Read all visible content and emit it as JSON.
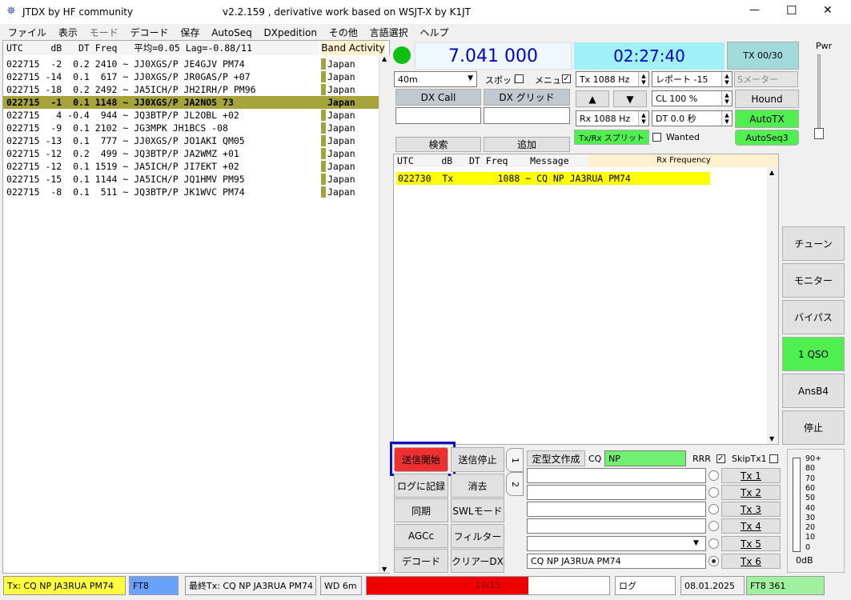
{
  "window": {
    "title": "JTDX  by HF community",
    "version": "v2.2.159 , derivative work based on WSJT-X by K1JT",
    "minimize": "—",
    "maximize": "☐",
    "close": "✕"
  },
  "menu": [
    "ファイル",
    "表示",
    "モード",
    "デコード",
    "保存",
    "AutoSeq",
    "DXpedition",
    "その他",
    "言語選択",
    "ヘルプ"
  ],
  "band_activity": {
    "header": "UTC     dB   DT Freq   平均=0.05 Lag=-0.88/11",
    "label": "Band Activity",
    "rows": [
      {
        "text": "022715  -2  0.2 2410 ~ JJ0XGS/P JE4GJV PM74",
        "country": "Japan",
        "highlight": false
      },
      {
        "text": "022715 -14  0.1  617 ~ JJ0XGS/P JR0GAS/P +07",
        "country": "Japan",
        "highlight": false
      },
      {
        "text": "022715 -18  0.2 2492 ~ JA5ICH/P JH2IRH/P PM96",
        "country": "Japan",
        "highlight": false
      },
      {
        "text": "022715  -1  0.1 1148 ~ JJ0XGS/P JA2NOS 73",
        "country": "Japan",
        "highlight": true
      },
      {
        "text": "022715   4 -0.4  944 ~ JQ3BTP/P JL2OBL +02",
        "country": "Japan",
        "highlight": false
      },
      {
        "text": "022715  -9  0.1 2102 ~ JG3MPK JH1BCS -08",
        "country": "Japan",
        "highlight": false
      },
      {
        "text": "022715 -13  0.1  777 ~ JJ0XGS/P JO1AKI QM05",
        "country": "Japan",
        "highlight": false
      },
      {
        "text": "022715 -12  0.2  499 ~ JQ3BTP/P JA2WMZ +01",
        "country": "Japan",
        "highlight": false
      },
      {
        "text": "022715 -12  0.1 1519 ~ JA5ICH/P JI7EKT +02",
        "country": "Japan",
        "highlight": false
      },
      {
        "text": "022715 -15  0.1 1144 ~ JA5ICH/P JQ1HMV PM95",
        "country": "Japan",
        "highlight": false
      },
      {
        "text": "022715  -8  0.1  511 ~ JQ3BTP/P JK1WVC PM74",
        "country": "Japan",
        "highlight": false
      }
    ]
  },
  "top": {
    "frequency": "7.041 000",
    "clock": "02:27:40",
    "tx_counter": "TX 00/30",
    "pwr_label": "Pwr"
  },
  "controls": {
    "band": "40m",
    "spot_label": "スポット",
    "menu_label": "メニュー",
    "menu_checked": "✓",
    "tx_freq": "Tx  1088  Hz",
    "report": "レポート -15",
    "s_meter": "Sメーター",
    "dx_call_btn": "DX Call",
    "dx_grid_btn": "DX グリッド",
    "up_arrow": "▲",
    "down_arrow": "▼",
    "cl": "CL  100 %",
    "hound": "Hound",
    "rx_freq": "Rx  1088  Hz",
    "dt": "DT 0.0 秒",
    "auto_tx": "AutoTX",
    "split": "Tx/Rx スプリット",
    "wanted": "Wanted",
    "autoseq": "AutoSeq3",
    "search": "検索",
    "add": "追加"
  },
  "rx_panel": {
    "header": "UTC     dB   DT Freq    Message",
    "rx_freq_label": "Rx Frequency",
    "line": "022730  Tx        1088 ~ CQ NP JA3RUA PM74"
  },
  "right_buttons": [
    "チューン",
    "モニター",
    "バイパス",
    "1 QSO",
    "AnsB4",
    "停止"
  ],
  "bottom_buttons": {
    "tx_enable": "送信開始",
    "halt_tx": "送信停止",
    "log": "ログに記録",
    "erase": "消去",
    "sync": "同期",
    "swl": "SWLモード",
    "agc": "AGCc",
    "filter": "フィルター",
    "decode": "デコード",
    "clear_dx": "クリアーDX"
  },
  "tx_messages": {
    "tab1": "1",
    "tab2": "2",
    "generate": "定型文作成",
    "cq_label": "CQ",
    "cq_value": "NP",
    "rrr": "RRR",
    "rrr_checked": "✓",
    "skip_tx1": "SkipTx1",
    "messages": [
      "",
      "",
      "",
      "",
      "",
      "CQ NP JA3RUA PM74"
    ],
    "tx_labels": [
      "Tx 1",
      "Tx 2",
      "Tx 3",
      "Tx 4",
      "Tx 5",
      "Tx 6"
    ]
  },
  "meter": {
    "scale": [
      "90+",
      "80",
      "70",
      "60",
      "50",
      "40",
      "30",
      "20",
      "10",
      "0"
    ],
    "db": "0dB"
  },
  "status_bar": {
    "tx_message": "Tx: CQ NP JA3RUA PM74",
    "mode": "FT8",
    "last_tx": "最終Tx: CQ NP JA3RUA PM74",
    "wd": "WD 6m",
    "progress_text": "10/15",
    "progress_fraction": 0.667,
    "log": "ログ",
    "date": "08.01.2025",
    "mode_count": "FT8  361"
  },
  "colors": {
    "highlight_row": "#a6a33a",
    "rx_line": "#ffff00",
    "freq_text": "#0000c8",
    "clock_bg": "#a0f0f8",
    "green": "#50ef50",
    "tx_enable": "#ef3030",
    "focus_border": "#1010c0"
  }
}
